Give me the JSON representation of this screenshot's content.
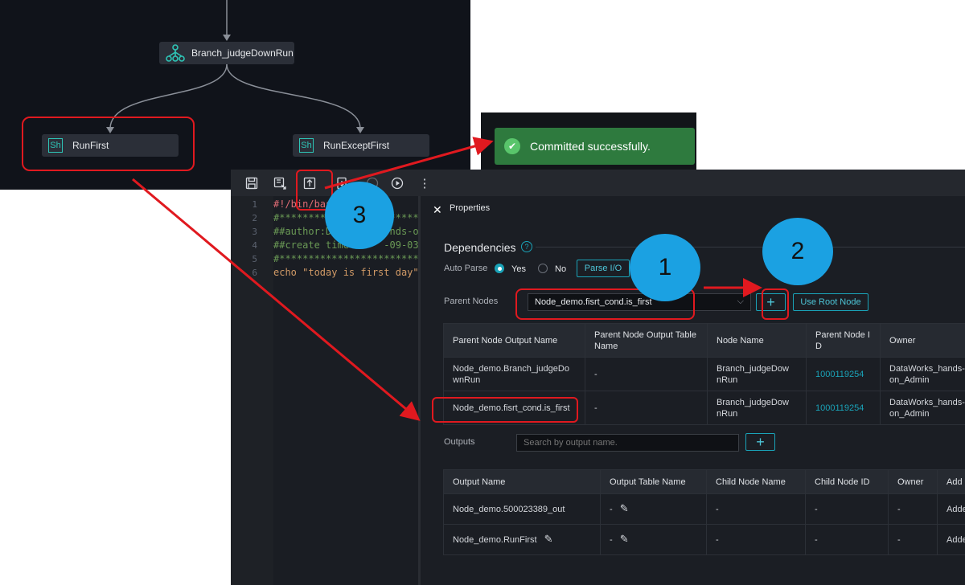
{
  "dag": {
    "nodes": {
      "branch": "Branch_judgeDownRun",
      "run_first": "RunFirst",
      "run_except_first": "RunExceptFirst"
    },
    "shell_badge": "Sh"
  },
  "toast": {
    "message": "Committed successfully."
  },
  "editor": {
    "line_numbers": [
      "1",
      "2",
      "3",
      "4",
      "5",
      "6"
    ],
    "code": [
      "#!/bin/bas",
      "#*******************************",
      "##author:D          nds-o",
      "##create time      -09-03 1",
      "#*******************************",
      "echo \"today is first day\""
    ]
  },
  "properties": {
    "title": "Properties",
    "close_icon": "✕",
    "dependencies": {
      "heading": "Dependencies",
      "auto_parse_label": "Auto Parse",
      "yes_label": "Yes",
      "no_label": "No",
      "parse_io_label": "Parse I/O",
      "parent_nodes_label": "Parent Nodes",
      "parent_nodes_value": "Node_demo.fisrt_cond.is_first",
      "add_symbol": "+",
      "use_root_label": "Use Root Node",
      "table": {
        "headers": [
          "Parent Node Output Name",
          "Parent Node Output Table Name",
          "Node Name",
          "Parent Node I D",
          "Owner"
        ],
        "rows": [
          {
            "output": "Node_demo.Branch_judgeDo wnRun",
            "table": "-",
            "node": "Branch_judgeDow nRun",
            "id": "1000119254",
            "owner": "DataWorks_hands-on_Admin"
          },
          {
            "output": "Node_demo.fisrt_cond.is_first",
            "table": "-",
            "node": "Branch_judgeDow nRun",
            "id": "1000119254",
            "owner": "DataWorks_hands-on_Admin"
          }
        ]
      }
    },
    "outputs": {
      "label": "Outputs",
      "search_placeholder": "Search by output name.",
      "add_symbol": "+",
      "table": {
        "headers": [
          "Output Name",
          "Output Table Name",
          "Child Node Name",
          "Child Node ID",
          "Owner",
          "Add"
        ],
        "rows": [
          {
            "output": "Node_demo.500023389_out",
            "table": "-",
            "child": "-",
            "id": "-",
            "owner": "-",
            "add": "Adde"
          },
          {
            "output": "Node_demo.RunFirst",
            "table": "-",
            "child": "-",
            "id": "-",
            "owner": "-",
            "add": "Adde"
          }
        ]
      }
    }
  },
  "callouts": [
    "1",
    "2",
    "3"
  ],
  "colors": {
    "annotation_red": "#e0191f",
    "callout_blue": "#1ba1e2",
    "accent_teal": "#1aa3b8",
    "toast_green": "#2e7a3e"
  }
}
